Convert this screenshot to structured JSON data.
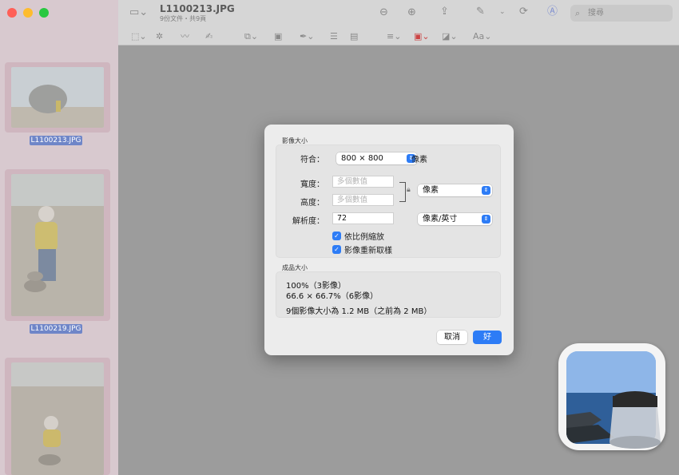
{
  "window": {
    "title": "L1100213.JPG",
    "subtitle": "9份文件・共9頁"
  },
  "toolbar": {
    "search_placeholder": "搜尋"
  },
  "sidebar": {
    "thumbnails": [
      {
        "label": "L1100213.JPG"
      },
      {
        "label": "L1100219.JPG"
      },
      {
        "label": ""
      }
    ]
  },
  "dialog": {
    "section_size_title": "影像大小",
    "fit_label": "符合：",
    "fit_value": "800 × 800",
    "fit_unit": "像素",
    "width_label": "寬度：",
    "width_placeholder": "多個數值",
    "height_label": "高度：",
    "height_placeholder": "多個數值",
    "dimension_unit": "像素",
    "resolution_label": "解析度：",
    "resolution_value": "72",
    "resolution_unit": "像素/英寸",
    "scale_proportionally": "依比例縮放",
    "resample_image": "影像重新取樣",
    "section_result_title": "成品大小",
    "result_line1": "100%（3影像）",
    "result_line2": "66.6 × 66.7%（6影像）",
    "result_line3": "9個影像大小為 1.2 MB（之前為 2 MB）",
    "cancel_label": "取消",
    "ok_label": "好"
  },
  "colors": {
    "accent": "#2d7cf6",
    "sidebar": "#d8c9cf",
    "canvas": "#9c9c9c"
  }
}
